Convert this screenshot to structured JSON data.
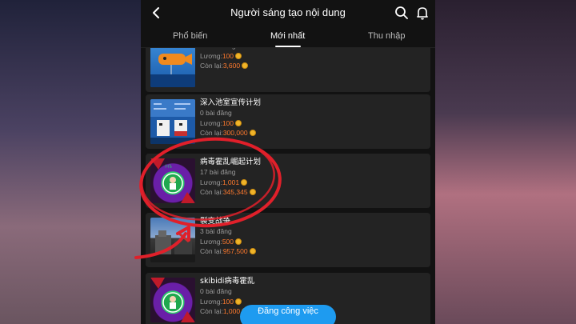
{
  "header": {
    "title": "Người sáng tạo nội dung",
    "back_icon": "chevron-left-icon",
    "search_icon": "search-icon",
    "bell_icon": "bell-icon"
  },
  "tabs": [
    {
      "label": "Phổ biến"
    },
    {
      "label": "Mới nhất",
      "active": true
    },
    {
      "label": "Thu nhập"
    }
  ],
  "cards": [
    {
      "name": "",
      "posts": "13 bài đăng",
      "salary_label": "Lương:",
      "salary": "100",
      "remain_label": "Còn lại:",
      "remain": "3,600"
    },
    {
      "name": "深入池室宣传计划",
      "posts": "0 bài đăng",
      "salary_label": "Lương:",
      "salary": "100",
      "remain_label": "Còn lại:",
      "remain": "300,000"
    },
    {
      "name": "病毒霍乱崛起计划",
      "posts": "17 bài đăng",
      "salary_label": "Lương:",
      "salary": "1,001",
      "remain_label": "Còn lại:",
      "remain": "345,345"
    },
    {
      "name": "裂变战争",
      "posts": "3 bài đăng",
      "salary_label": "Lương:",
      "salary": "500",
      "remain_label": "Còn lại:",
      "remain": "957,500"
    },
    {
      "name": "skibidi病毒霍乱",
      "posts": "0 bài đăng",
      "salary_label": "Lương:",
      "salary": "100",
      "remain_label": "Còn lại:",
      "remain": "1,000"
    }
  ],
  "post_button": {
    "label": "Đăng công việc"
  },
  "colors": {
    "accent_orange": "#ff7a2e",
    "button_blue": "#1e9bf0",
    "annotation_red": "#e0202a",
    "coin": "#f0b429"
  }
}
